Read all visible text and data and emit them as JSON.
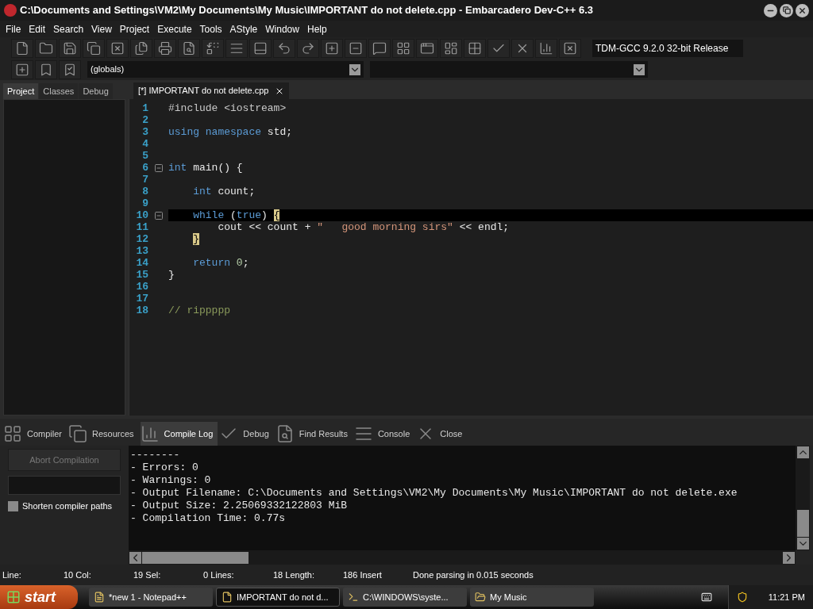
{
  "window": {
    "title": "C:\\Documents and Settings\\VM2\\My Documents\\My Music\\IMPORTANT do not delete.cpp - Embarcadero Dev-C++ 6.3"
  },
  "menu": [
    "File",
    "Edit",
    "Search",
    "View",
    "Project",
    "Execute",
    "Tools",
    "AStyle",
    "Window",
    "Help"
  ],
  "compiler_select": "TDM-GCC 9.2.0 32-bit Release",
  "scope_select": "(globals)",
  "side_tabs": [
    {
      "label": "Project",
      "selected": true
    },
    {
      "label": "Classes",
      "selected": false
    },
    {
      "label": "Debug",
      "selected": false
    }
  ],
  "editor_tab": {
    "label": "[*] IMPORTANT do not delete.cpp",
    "selected": true
  },
  "code": [
    {
      "number": "1",
      "current": false,
      "fold": false,
      "tokens": [
        {
          "kind": "pre",
          "text": "#include <iostream>"
        }
      ]
    },
    {
      "number": "2",
      "current": false,
      "fold": false
    },
    {
      "number": "3",
      "current": false,
      "fold": false,
      "tokens": [
        {
          "kind": "kw",
          "text": "using namespace"
        },
        {
          "kind": "plain",
          "text": " std;"
        }
      ]
    },
    {
      "number": "4",
      "current": false,
      "fold": false
    },
    {
      "number": "5",
      "current": false,
      "fold": false
    },
    {
      "number": "6",
      "current": false,
      "fold": true,
      "tokens": [
        {
          "kind": "kw",
          "text": "int"
        },
        {
          "kind": "plain",
          "text": " main() {"
        }
      ]
    },
    {
      "number": "7",
      "current": false,
      "fold": false
    },
    {
      "number": "8",
      "current": false,
      "fold": false,
      "tokens": [
        {
          "kind": "kw",
          "text": "    int"
        },
        {
          "kind": "plain",
          "text": " count;"
        }
      ]
    },
    {
      "number": "9",
      "current": false,
      "fold": false
    },
    {
      "number": "10",
      "current": true,
      "fold": true,
      "tokens": [
        {
          "kind": "kw",
          "text": "    while"
        },
        {
          "kind": "plain",
          "text": " ("
        },
        {
          "kind": "kw",
          "text": "true"
        },
        {
          "kind": "plain",
          "text": ") "
        },
        {
          "kind": "brace",
          "text": "{"
        }
      ]
    },
    {
      "number": "11",
      "current": false,
      "fold": false,
      "tokens": [
        {
          "kind": "plain",
          "text": "        cout << count + "
        },
        {
          "kind": "str",
          "text": "\"   good morning sirs\""
        },
        {
          "kind": "plain",
          "text": " << endl;"
        }
      ]
    },
    {
      "number": "12",
      "current": false,
      "fold": false,
      "tokens": [
        {
          "kind": "brace",
          "text": "    }"
        }
      ]
    },
    {
      "number": "13",
      "current": false,
      "fold": false
    },
    {
      "number": "14",
      "current": false,
      "fold": false,
      "tokens": [
        {
          "kind": "kw",
          "text": "    return"
        },
        {
          "kind": "num",
          "text": " 0"
        },
        {
          "kind": "plain",
          "text": ";"
        }
      ]
    },
    {
      "number": "15",
      "current": false,
      "fold": false,
      "tokens": [
        {
          "kind": "plain",
          "text": "}"
        }
      ]
    },
    {
      "number": "16",
      "current": false,
      "fold": false
    },
    {
      "number": "17",
      "current": false,
      "fold": false
    },
    {
      "number": "18",
      "current": false,
      "fold": false,
      "tokens": [
        {
          "kind": "cmt",
          "text": "// rippppp"
        }
      ]
    }
  ],
  "bottom_tabs": [
    {
      "label": "Compiler",
      "selected": false
    },
    {
      "label": "Resources",
      "selected": false
    },
    {
      "label": "Compile Log",
      "selected": true
    },
    {
      "label": "Debug",
      "selected": false
    },
    {
      "label": "Find Results",
      "selected": false
    },
    {
      "label": "Console",
      "selected": false
    },
    {
      "label": "Close",
      "selected": false
    }
  ],
  "abort_button": {
    "label": "Abort Compilation",
    "disabled": true
  },
  "shorten_paths": {
    "label": "Shorten compiler paths",
    "checked": false
  },
  "log": [
    "--------",
    "- Errors: 0",
    "- Warnings: 0",
    "- Output Filename: C:\\Documents and Settings\\VM2\\My Documents\\My Music\\IMPORTANT do not delete.exe",
    "- Output Size: 2.25069332122803 MiB",
    "- Compilation Time: 0.77s"
  ],
  "status_bar": [
    "Line:",
    "10 Col:",
    "19 Sel:",
    "0 Lines:",
    "18 Length:",
    "186 Insert",
    "Done parsing in 0.015 seconds"
  ],
  "taskbar": {
    "start": "start",
    "tasks": [
      {
        "label": "*new 1 - Notepad++",
        "selected": false
      },
      {
        "label": "IMPORTANT do not d...",
        "selected": true
      },
      {
        "label": "C:\\WINDOWS\\syste...",
        "selected": false
      },
      {
        "label": "My Music",
        "selected": false
      }
    ],
    "clock": "11:21 PM"
  }
}
